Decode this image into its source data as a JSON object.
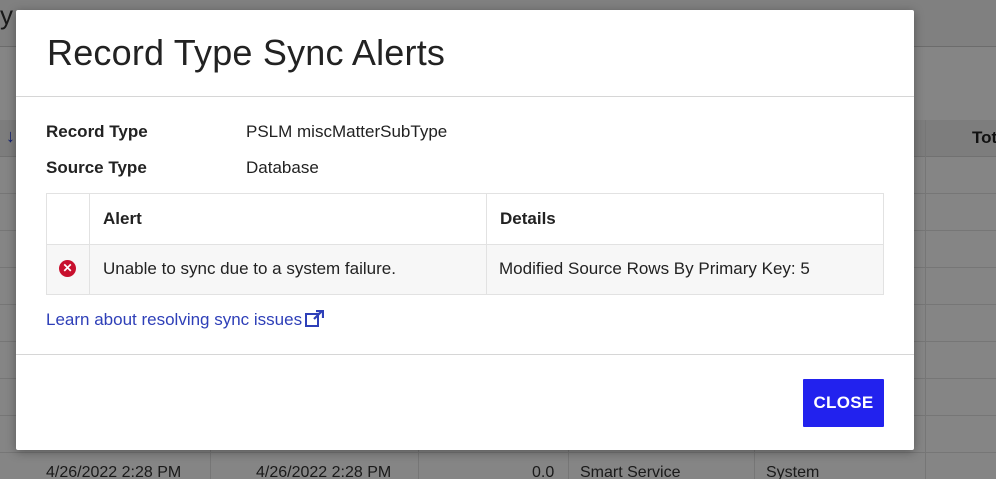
{
  "background": {
    "title_fragment": "y",
    "sort_arrow": "↓",
    "column_header_fragment": "Tot",
    "bottom_row": [
      "4/26/2022 2:28 PM",
      "4/26/2022 2:28 PM",
      "0.0",
      "Smart Service",
      "System"
    ]
  },
  "modal": {
    "title": "Record Type Sync Alerts",
    "fields": {
      "record_type_label": "Record Type",
      "record_type_value": "PSLM miscMatterSubType",
      "source_type_label": "Source Type",
      "source_type_value": "Database"
    },
    "table": {
      "headers": [
        "",
        "Alert",
        "Details"
      ],
      "rows": [
        {
          "status_icon": "error-circle-icon",
          "alert": "Unable to sync due to a system failure.",
          "details": "Modified Source Rows By Primary Key: 5"
        }
      ]
    },
    "learn_link": "Learn about resolving sync issues",
    "close_label": "CLOSE"
  },
  "colors": {
    "primary_button": "#2222ee",
    "link": "#2e3fb8",
    "error": "#c8102e",
    "overlay": "rgba(0,0,0,0.48)"
  }
}
